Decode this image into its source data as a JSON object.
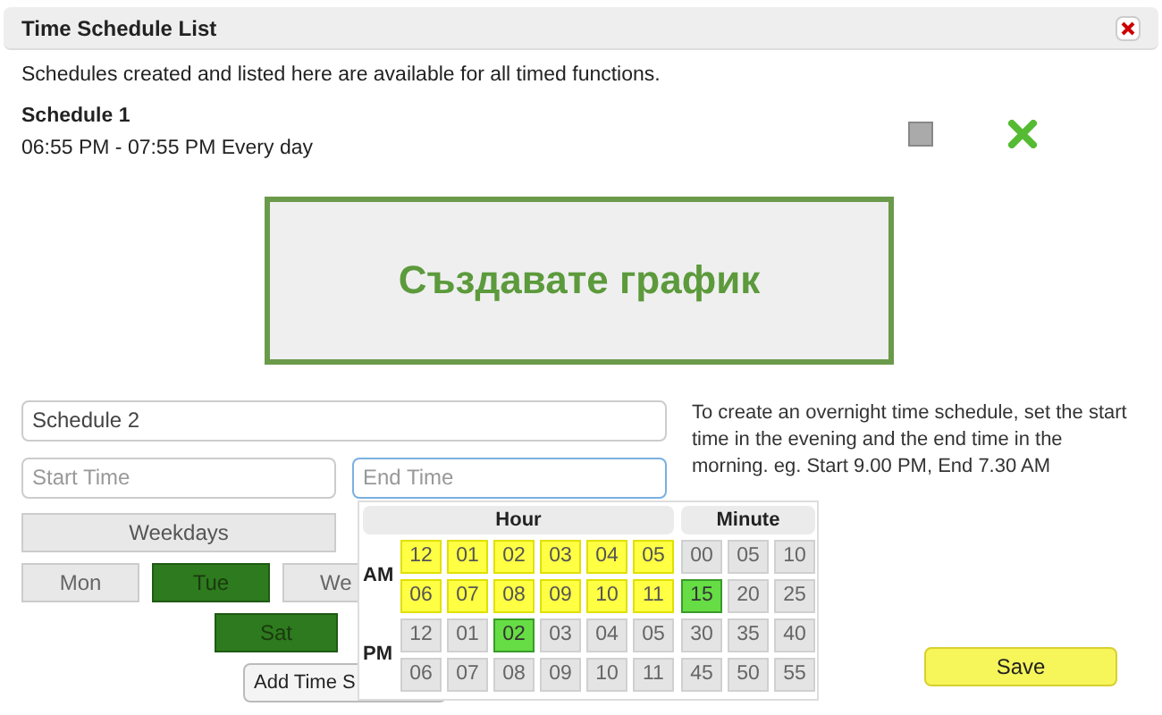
{
  "dialog": {
    "title": "Time Schedule List"
  },
  "intro": "Schedules created and listed here are available for all timed functions.",
  "schedules": [
    {
      "name": "Schedule 1",
      "time": "06:55 PM - 07:55 PM Every day",
      "enabled": false
    }
  ],
  "create_button": "Създавате график",
  "form": {
    "name_value": "Schedule 2",
    "start_placeholder": "Start Time",
    "end_placeholder": "End Time",
    "end_focused": true,
    "weekdays_button": "Weekdays",
    "days": [
      {
        "label": "Mon",
        "selected": false
      },
      {
        "label": "Tue",
        "selected": true
      },
      {
        "label": "We",
        "selected": false
      }
    ],
    "weekend_days": [
      {
        "label": "Sat",
        "selected": true
      }
    ],
    "add_button": "Add Time S",
    "help": "To create an overnight time schedule, set the start time in the evening and the end time in the morning. eg. Start 9.00 PM, End 7.30 AM",
    "save_button": "Save"
  },
  "time_picker": {
    "hour_header": "Hour",
    "minute_header": "Minute",
    "periods": [
      {
        "label": "AM",
        "rows": [
          [
            {
              "label": "12",
              "highlighted": true,
              "selected": false
            },
            {
              "label": "01",
              "highlighted": true,
              "selected": false
            },
            {
              "label": "02",
              "highlighted": true,
              "selected": false
            },
            {
              "label": "03",
              "highlighted": true,
              "selected": false
            },
            {
              "label": "04",
              "highlighted": true,
              "selected": false
            },
            {
              "label": "05",
              "highlighted": true,
              "selected": false
            }
          ],
          [
            {
              "label": "06",
              "highlighted": true,
              "selected": false
            },
            {
              "label": "07",
              "highlighted": true,
              "selected": false
            },
            {
              "label": "08",
              "highlighted": true,
              "selected": false
            },
            {
              "label": "09",
              "highlighted": true,
              "selected": false
            },
            {
              "label": "10",
              "highlighted": true,
              "selected": false
            },
            {
              "label": "11",
              "highlighted": true,
              "selected": false
            }
          ]
        ]
      },
      {
        "label": "PM",
        "rows": [
          [
            {
              "label": "12",
              "highlighted": false,
              "selected": false
            },
            {
              "label": "01",
              "highlighted": false,
              "selected": false
            },
            {
              "label": "02",
              "highlighted": false,
              "selected": true
            },
            {
              "label": "03",
              "highlighted": false,
              "selected": false
            },
            {
              "label": "04",
              "highlighted": false,
              "selected": false
            },
            {
              "label": "05",
              "highlighted": false,
              "selected": false
            }
          ],
          [
            {
              "label": "06",
              "highlighted": false,
              "selected": false
            },
            {
              "label": "07",
              "highlighted": false,
              "selected": false
            },
            {
              "label": "08",
              "highlighted": false,
              "selected": false
            },
            {
              "label": "09",
              "highlighted": false,
              "selected": false
            },
            {
              "label": "10",
              "highlighted": false,
              "selected": false
            },
            {
              "label": "11",
              "highlighted": false,
              "selected": false
            }
          ]
        ]
      }
    ],
    "minutes": [
      [
        {
          "label": "00",
          "selected": false
        },
        {
          "label": "05",
          "selected": false
        },
        {
          "label": "10",
          "selected": false
        }
      ],
      [
        {
          "label": "15",
          "selected": true
        },
        {
          "label": "20",
          "selected": false
        },
        {
          "label": "25",
          "selected": false
        }
      ],
      [
        {
          "label": "30",
          "selected": false
        },
        {
          "label": "35",
          "selected": false
        },
        {
          "label": "40",
          "selected": false
        }
      ],
      [
        {
          "label": "45",
          "selected": false
        },
        {
          "label": "50",
          "selected": false
        },
        {
          "label": "55",
          "selected": false
        }
      ]
    ]
  }
}
